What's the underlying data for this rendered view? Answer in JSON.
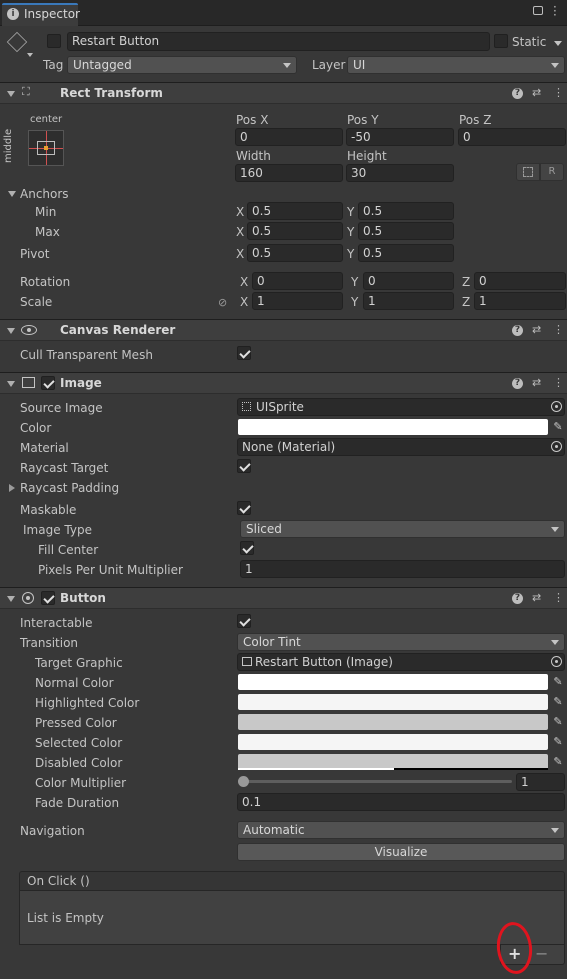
{
  "tab": {
    "title": "Inspector"
  },
  "object": {
    "name": "Restart Button",
    "active": false,
    "static_label": "Static",
    "tag_label": "Tag",
    "tag_value": "Untagged",
    "layer_label": "Layer",
    "layer_value": "UI"
  },
  "rect_transform": {
    "title": "Rect Transform",
    "anchor_h": "center",
    "anchor_v": "middle",
    "pos_x_label": "Pos X",
    "pos_x": "0",
    "pos_y_label": "Pos Y",
    "pos_y": "-50",
    "pos_z_label": "Pos Z",
    "pos_z": "0",
    "width_label": "Width",
    "width": "160",
    "height_label": "Height",
    "height": "30",
    "r_button": "R",
    "anchors_label": "Anchors",
    "min_label": "Min",
    "min_x": "0.5",
    "min_y": "0.5",
    "max_label": "Max",
    "max_x": "0.5",
    "max_y": "0.5",
    "pivot_label": "Pivot",
    "pivot_x": "0.5",
    "pivot_y": "0.5",
    "rotation_label": "Rotation",
    "rot_x": "0",
    "rot_y": "0",
    "rot_z": "0",
    "scale_label": "Scale",
    "scale_x": "1",
    "scale_y": "1",
    "scale_z": "1",
    "x": "X",
    "y": "Y",
    "z": "Z"
  },
  "canvas_renderer": {
    "title": "Canvas Renderer",
    "cull_label": "Cull Transparent Mesh",
    "cull_value": true
  },
  "image": {
    "title": "Image",
    "source_label": "Source Image",
    "source_value": "UISprite",
    "color_label": "Color",
    "color_value": "#ffffff",
    "material_label": "Material",
    "material_value": "None (Material)",
    "raycast_label": "Raycast Target",
    "raycast_padding_label": "Raycast Padding",
    "maskable_label": "Maskable",
    "image_type_label": "Image Type",
    "image_type_value": "Sliced",
    "fill_center_label": "Fill Center",
    "ppu_label": "Pixels Per Unit Multiplier",
    "ppu_value": "1"
  },
  "button": {
    "title": "Button",
    "interactable_label": "Interactable",
    "transition_label": "Transition",
    "transition_value": "Color Tint",
    "target_label": "Target Graphic",
    "target_value": "Restart Button (Image)",
    "normal_label": "Normal Color",
    "normal_color": "#ffffff",
    "highlighted_label": "Highlighted Color",
    "highlighted_color": "#f5f5f5",
    "pressed_label": "Pressed Color",
    "pressed_color": "#c8c8c8",
    "selected_label": "Selected Color",
    "selected_color": "#f5f5f5",
    "disabled_label": "Disabled Color",
    "disabled_color": "#c8c8c8",
    "multiplier_label": "Color Multiplier",
    "multiplier_value": "1",
    "fade_label": "Fade Duration",
    "fade_value": "0.1",
    "navigation_label": "Navigation",
    "navigation_value": "Automatic",
    "visualize_label": "Visualize"
  },
  "on_click": {
    "header": "On Click ()",
    "empty_text": "List is Empty",
    "add_symbol": "+",
    "remove_symbol": "−"
  },
  "colors": {
    "panel": "#383838",
    "header": "#3e3e3e",
    "field": "#2a2a2a",
    "annotation": "#e0141e"
  }
}
